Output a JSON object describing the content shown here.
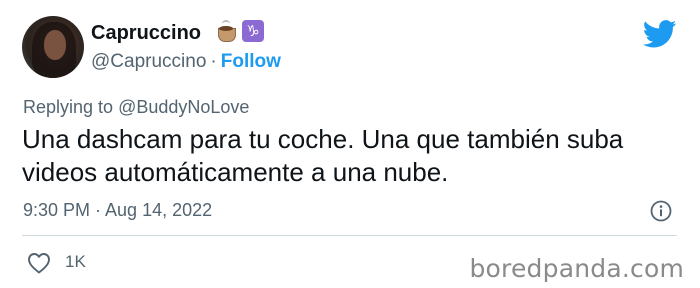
{
  "author": {
    "display_name": "Capruccino",
    "name_emojis": [
      "coffee-icon",
      "capricorn-icon"
    ],
    "capricorn_glyph": "♑",
    "handle": "@Capruccino",
    "separator": "·",
    "follow_label": "Follow"
  },
  "reply": {
    "prefix": "Replying to",
    "mention": "@BuddyNoLove"
  },
  "tweet": {
    "text": "Una dashcam para tu coche. Una que también suba\nvideos automáticamente a una nube.",
    "timestamp": "9:30 PM · Aug 14, 2022"
  },
  "actions": {
    "like_count": "1K"
  },
  "watermark": "boredpanda.com",
  "colors": {
    "accent": "#1d9bf0",
    "text_primary": "#0f1419",
    "text_secondary": "#536471",
    "divider": "#cfd9de"
  }
}
